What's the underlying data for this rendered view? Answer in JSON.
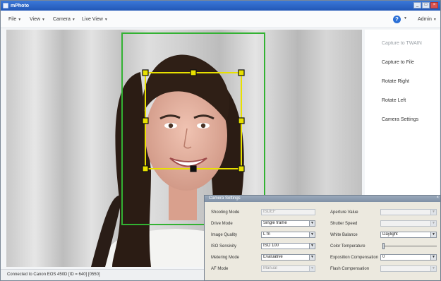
{
  "window": {
    "title": "mPhoto"
  },
  "menubar": {
    "menus": [
      {
        "label": "File"
      },
      {
        "label": "View"
      },
      {
        "label": "Camera"
      },
      {
        "label": "Live View"
      }
    ],
    "help_label": "?",
    "user_label": "Admin"
  },
  "side_panel": {
    "actions": [
      {
        "label": "Capture to TWAIN",
        "enabled": false
      },
      {
        "label": "Capture to File",
        "enabled": true
      },
      {
        "label": "Rotate Right",
        "enabled": true
      },
      {
        "label": "Rotate Left",
        "enabled": true
      },
      {
        "label": "Camera Settings",
        "enabled": true
      }
    ]
  },
  "status": {
    "text": "Connected to Canon EOS 450D [ID = 640] [0550]"
  },
  "camera_settings": {
    "title": "Camera Settings",
    "left_fields": [
      {
        "label": "Shooting Mode",
        "value": "ISDEF",
        "disabled": true,
        "type": "text"
      },
      {
        "label": "Drive Mode",
        "value": "Single frame",
        "disabled": false,
        "type": "select"
      },
      {
        "label": "Image Quality",
        "value": "L fn",
        "disabled": false,
        "type": "select"
      },
      {
        "label": "ISO Sensivity",
        "value": "ISO 100",
        "disabled": false,
        "type": "select"
      },
      {
        "label": "Metering Mode",
        "value": "Evaluative",
        "disabled": false,
        "type": "select"
      },
      {
        "label": "AF Mode",
        "value": "Manual",
        "disabled": true,
        "type": "select"
      }
    ],
    "right_fields": [
      {
        "label": "Aperture Value",
        "value": "",
        "disabled": true,
        "type": "select"
      },
      {
        "label": "Shutter Speed",
        "value": "",
        "disabled": true,
        "type": "select"
      },
      {
        "label": "White Balance",
        "value": "Daylight",
        "disabled": false,
        "type": "select"
      },
      {
        "label": "Color Temperature",
        "value": "",
        "disabled": false,
        "type": "slider",
        "level": 0.0
      },
      {
        "label": "Exposition Compensation",
        "value": "0",
        "disabled": false,
        "type": "select"
      },
      {
        "label": "Flash Compensation",
        "value": "",
        "disabled": true,
        "type": "select"
      }
    ]
  },
  "icons": {
    "dropdown": "chevron-down-icon",
    "help": "help-icon"
  },
  "colors": {
    "face_frame": "#33b233",
    "crop_frame": "#e8e000",
    "titlebar": "#2a62c4"
  }
}
